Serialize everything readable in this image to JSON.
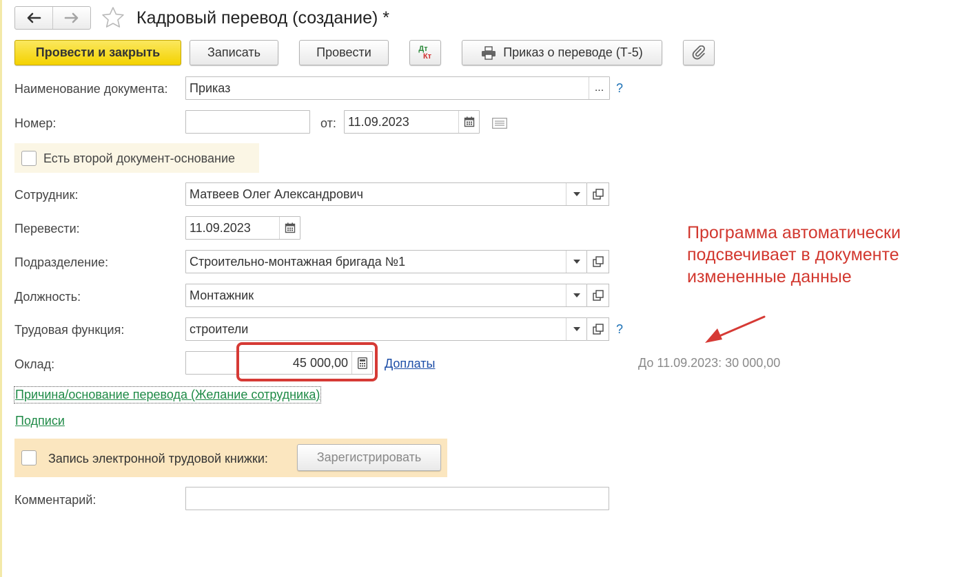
{
  "window": {
    "title": "Кадровый перевод (создание) *"
  },
  "icons": {
    "back": "arrow-left-icon",
    "forward": "arrow-right-icon",
    "favorite": "star-icon",
    "dtkt": "dt-kt-icon",
    "print": "printer-icon",
    "attach": "paperclip-icon",
    "calendar": "calendar-icon",
    "calculator": "calculator-icon",
    "dropdown": "chevron-down-icon",
    "open": "open-form-icon",
    "history": "list-icon"
  },
  "toolbar": {
    "post_close_label": "Провести и закрыть",
    "save_label": "Записать",
    "post_label": "Провести",
    "dtkt_top": "Дт",
    "dtkt_bottom": "Кт",
    "print_label": "Приказ о переводе (Т-5)"
  },
  "form": {
    "doc_name": {
      "label": "Наименование документа:",
      "value": "Приказ",
      "ellipsis": "...",
      "help": "?"
    },
    "number": {
      "label": "Номер:",
      "value": ""
    },
    "date": {
      "label": "от:",
      "value": "11.09.2023"
    },
    "second_basis": {
      "label": "Есть второй документ-основание",
      "checked": false
    },
    "employee": {
      "label": "Сотрудник:",
      "value": "Матвеев Олег Александрович"
    },
    "transfer_date": {
      "label": "Перевести:",
      "value": "11.09.2023"
    },
    "department": {
      "label": "Подразделение:",
      "value": "Строительно-монтажная бригада №1"
    },
    "position": {
      "label": "Должность:",
      "value": "Монтажник"
    },
    "labor_function": {
      "label": "Трудовая функция:",
      "value": "строители",
      "help": "?"
    },
    "salary": {
      "label": "Оклад:",
      "value": "45 000,00",
      "extra_link": "Доплаты",
      "previous": "До 11.09.2023: 30 000,00"
    },
    "reason_link": "Причина/основание перевода (Желание сотрудника)",
    "signatures_link": "Подписи",
    "etk": {
      "label": "Запись электронной трудовой книжки:",
      "button": "Зарегистрировать",
      "checked": false
    },
    "comment": {
      "label": "Комментарий:",
      "value": ""
    }
  },
  "annotation": {
    "text": "Программа автоматически подсвечивает в документе измененные данные",
    "color": "#d2382f"
  },
  "colors": {
    "primary_button": "#f4d200",
    "link_blue": "#1d4ea7",
    "link_green": "#1e8a46",
    "help": "#1a6fb5",
    "highlight": "#d63a35"
  }
}
